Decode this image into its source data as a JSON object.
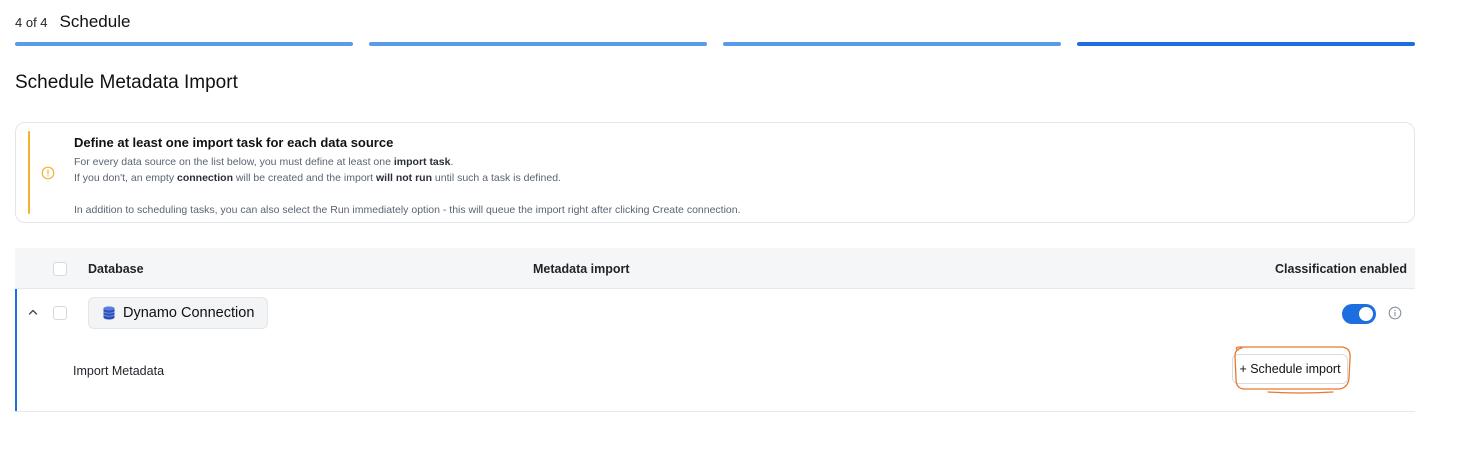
{
  "wizard": {
    "step_count": "4 of 4",
    "step_title": "Schedule",
    "progress_steps": 4,
    "current_step": 4
  },
  "section": {
    "title": "Schedule Metadata Import"
  },
  "notice": {
    "title": "Define at least one import task for each data source",
    "line1_a": "For every data source on the list below, you must define at least one ",
    "line1_b": "import task",
    "line1_c": ".",
    "line2_a": "If you don't, an empty ",
    "line2_b": "connection",
    "line2_c": " will be created and the import ",
    "line2_d": "will not run",
    "line2_e": " until such a task is defined.",
    "line3": "In addition to scheduling tasks, you can also select the Run immediately option - this will queue the import right after clicking Create connection.",
    "icon": "warning-circle-icon",
    "accent_color": "#f2b233"
  },
  "table": {
    "columns": {
      "database": "Database",
      "metadata_import": "Metadata import",
      "classification": "Classification enabled"
    },
    "rows": [
      {
        "database": "Dynamo Connection",
        "classification_enabled": true,
        "expanded": true,
        "detail_label": "Import Metadata",
        "action_label": "+ Schedule import"
      }
    ]
  },
  "colors": {
    "primary": "#1d6fe0",
    "progress_done": "#5a9be8",
    "annotation": "#e8772e"
  }
}
